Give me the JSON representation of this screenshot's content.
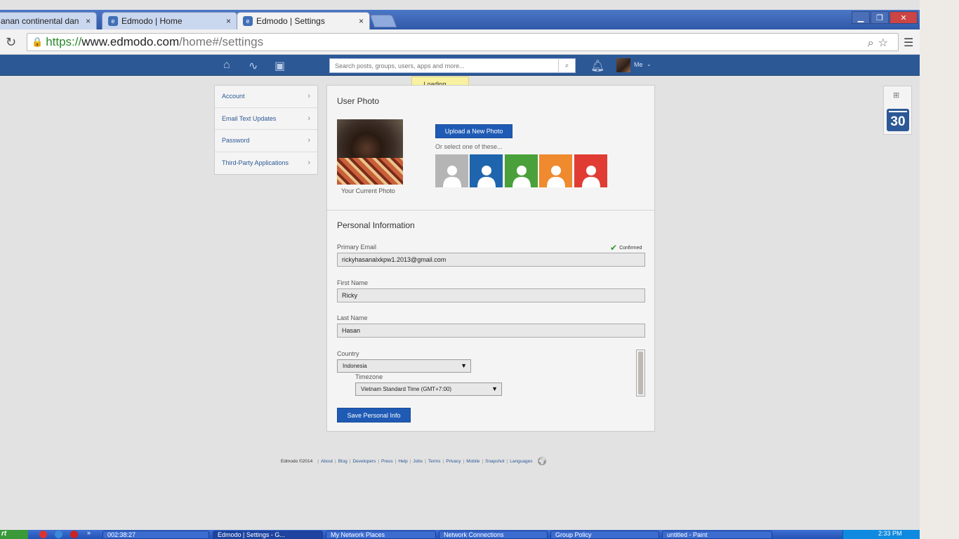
{
  "browser": {
    "tabs": [
      {
        "title": "anan continental dan ori",
        "active": false
      },
      {
        "title": "Edmodo | Home",
        "active": false
      },
      {
        "title": "Edmodo | Settings",
        "active": true
      }
    ],
    "tab_close": "×",
    "url": {
      "scheme": "https://",
      "host": "www.edmodo.com",
      "path": "/home#/settings"
    },
    "window_controls": {
      "minimize": "▁",
      "restore": "❐",
      "close": "✕"
    }
  },
  "nav": {
    "search_placeholder": "Search posts, groups, users, apps and more...",
    "me_label": "Me",
    "icons": [
      "home-icon",
      "activity-icon",
      "backpack-icon",
      "bell-icon"
    ]
  },
  "loading_text": "Loading......",
  "sidebar": {
    "items": [
      {
        "label": "Account"
      },
      {
        "label": "Email Text Updates"
      },
      {
        "label": "Password"
      },
      {
        "label": "Third-Party Applications"
      }
    ]
  },
  "user_photo": {
    "title": "User Photo",
    "caption": "Your Current Photo",
    "upload_label": "Upload a New Photo",
    "or_select": "Or select one of these...",
    "preset_colors": [
      "#b5b5b5",
      "#1f65ad",
      "#4aa03a",
      "#ef8a2e",
      "#e03c34"
    ]
  },
  "personal_info": {
    "title": "Personal Information",
    "primary_email_label": "Primary Email",
    "confirmed_label": "Confirmed",
    "primary_email_value": "rickyhasanalxkpw1.2013@gmail.com",
    "first_name_label": "First Name",
    "first_name_value": "Ricky",
    "last_name_label": "Last Name",
    "last_name_value": "Hasan",
    "country_label": "Country",
    "country_value": "Indonesia",
    "timezone_label": "Timezone",
    "timezone_value": "Vietnam Standard Time (GMT+7:00)",
    "save_label": "Save Personal Info"
  },
  "calendar_day": "30",
  "footer": {
    "copyright": "Edmodo ©2014",
    "links": [
      "About",
      "Blog",
      "Developers",
      "Press",
      "Help",
      "Jobs",
      "Terms",
      "Privacy",
      "Mobile",
      "Snapshot",
      "Languages"
    ]
  },
  "taskbar": {
    "start": "rt",
    "tasks": [
      {
        "label": "002:38:27"
      },
      {
        "label": "Edmodo | Settings - G..."
      },
      {
        "label": "My Network Places"
      },
      {
        "label": "Network Connections"
      },
      {
        "label": "Group Policy"
      },
      {
        "label": "untitled - Paint"
      }
    ],
    "clock": "2:33 PM"
  }
}
